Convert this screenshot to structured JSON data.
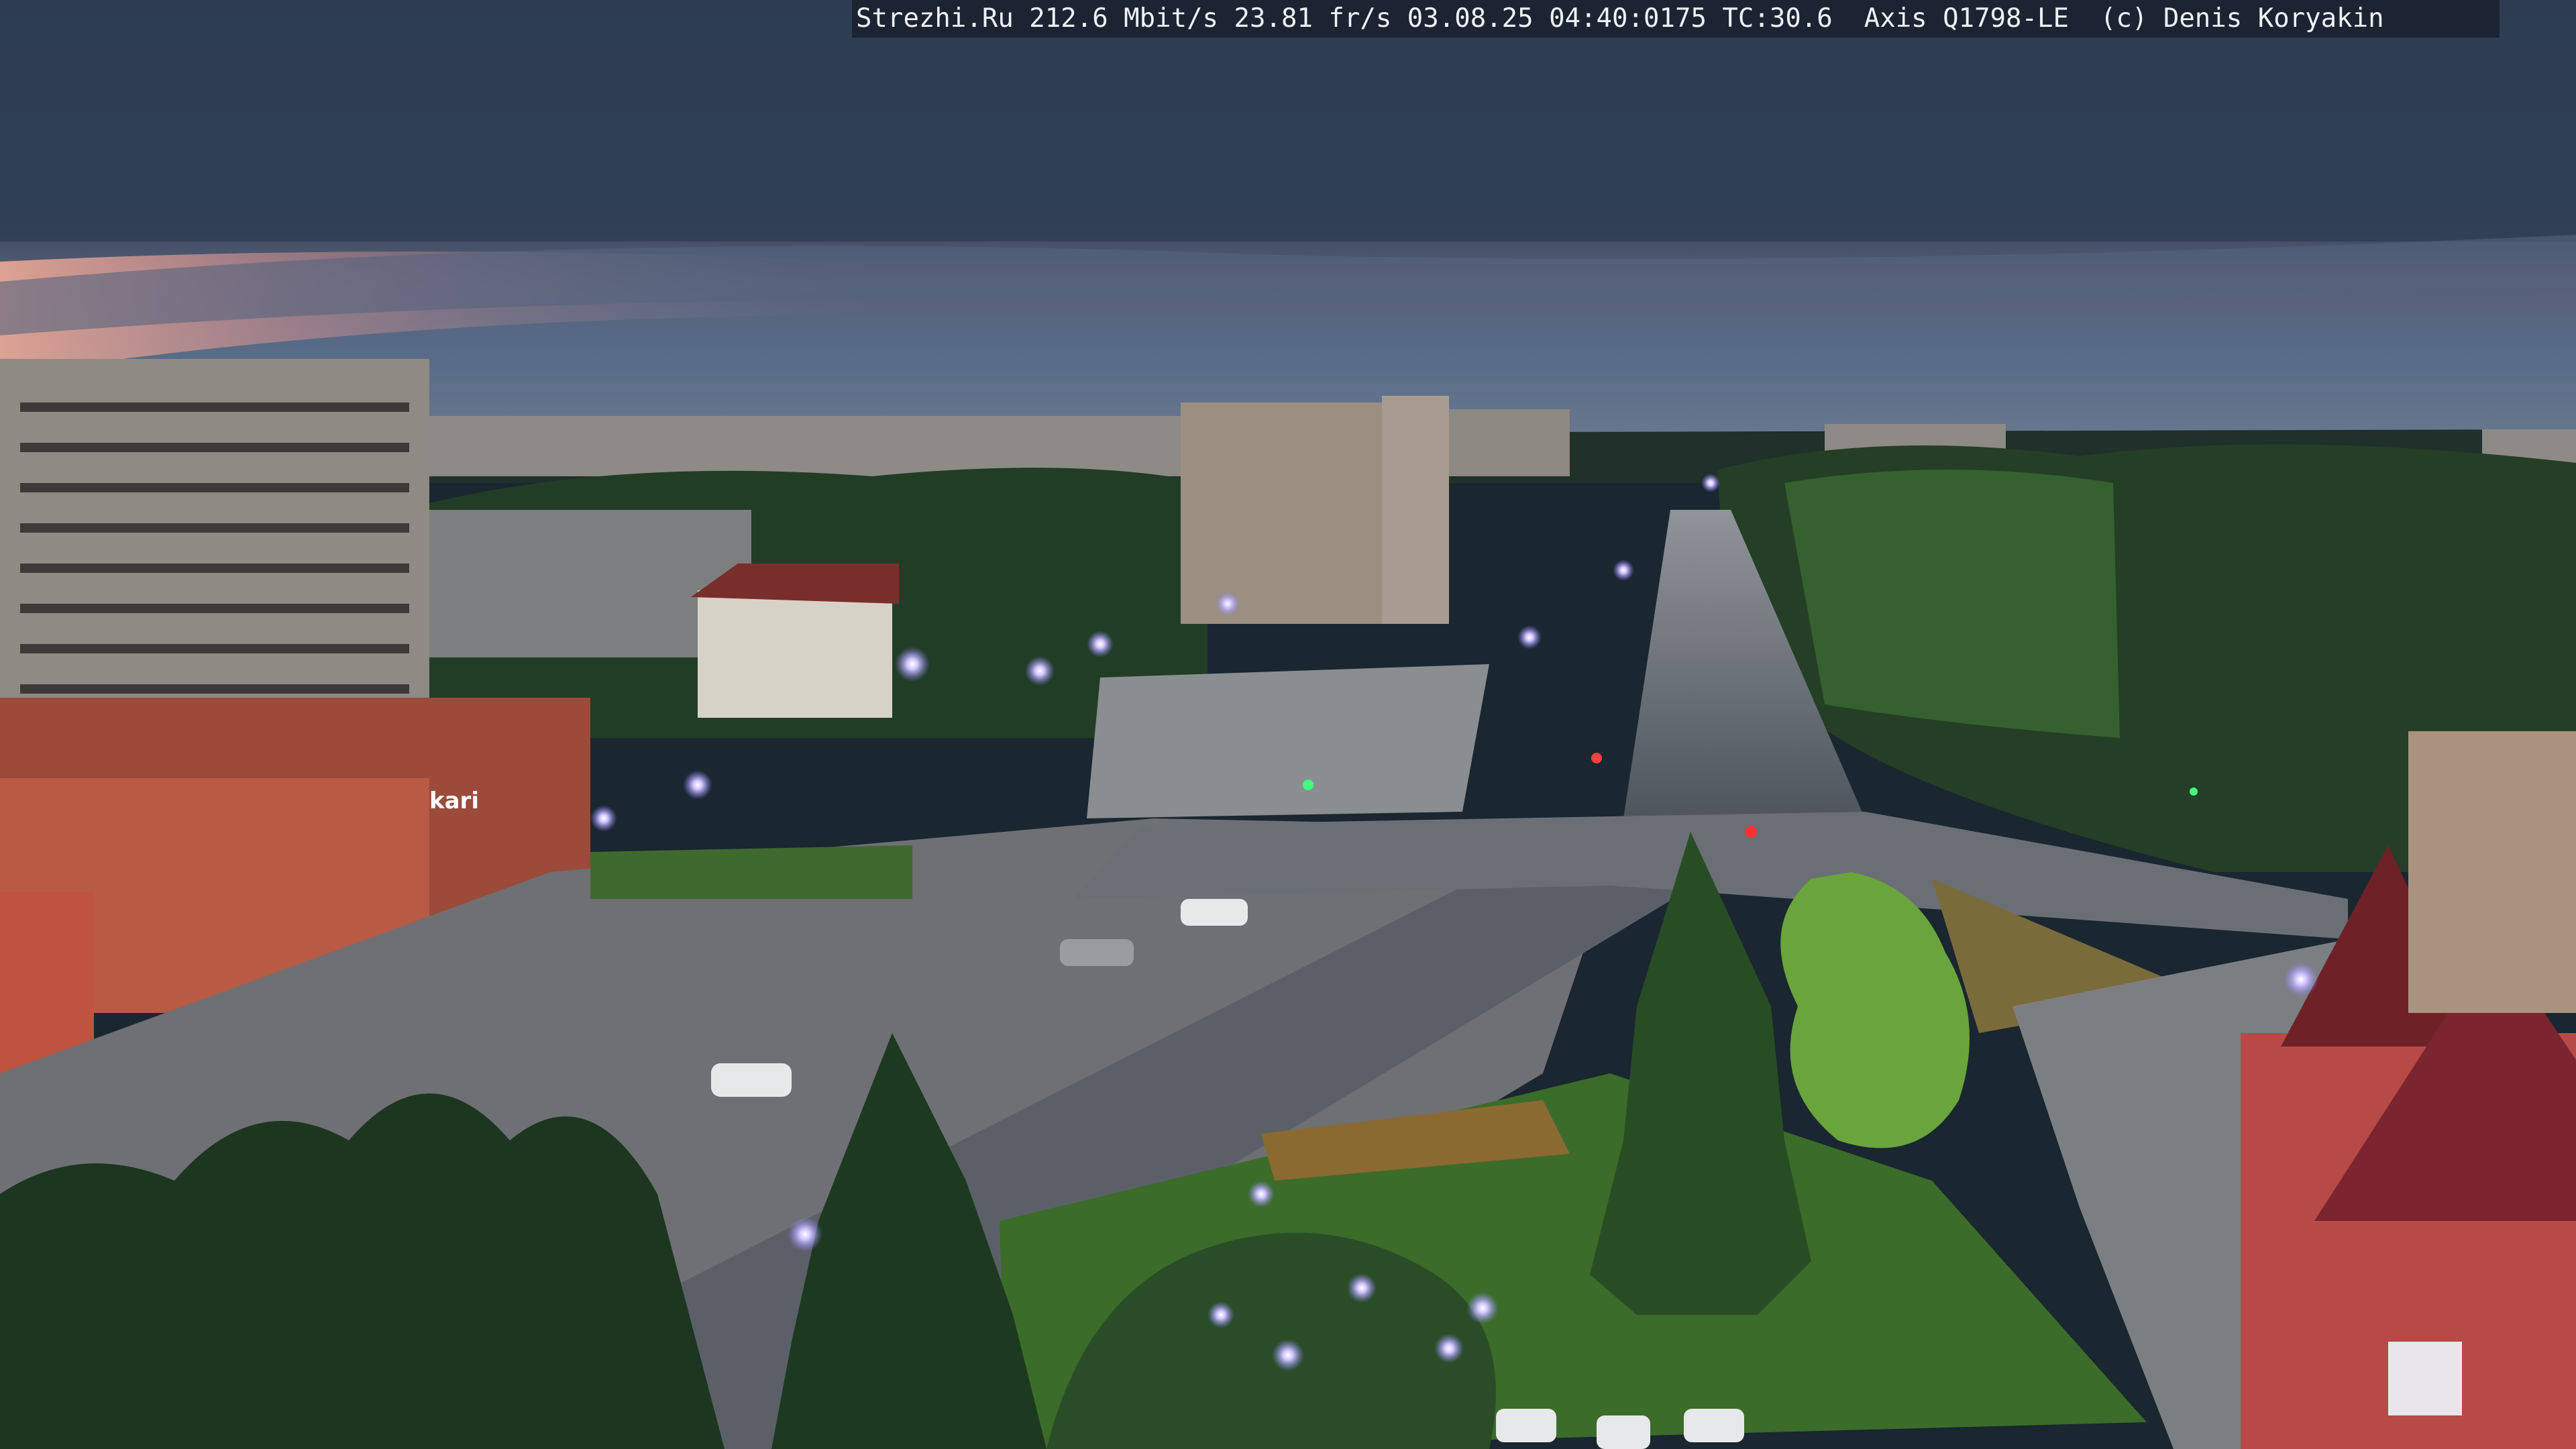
{
  "overlay": {
    "text": "Strezhi.Ru 212.6 Mbit/s 23.81 fr/s 03.08.25 04:40:0175 TC:30.6  Axis Q1798-LE  (c) Denis Koryakin"
  },
  "scene": {
    "description_colors": {
      "sky_top": "#2a3a4e",
      "sky_mid": "#33455e",
      "sunset_glow": "#d99a8e",
      "horizon": "#4e5f78",
      "trees": "#1f3a22",
      "trees_light": "#4f7a3a",
      "road": "#5a616a",
      "grass": "#3d6e2e",
      "brick": "#b5463f",
      "building": "#a39a8c",
      "lamp": "#b9a9ff"
    }
  }
}
